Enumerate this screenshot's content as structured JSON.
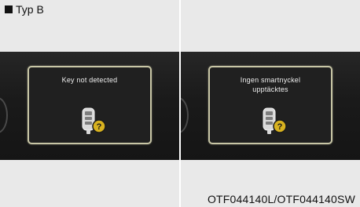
{
  "section": {
    "label": "Typ B"
  },
  "screens": [
    {
      "message": "Key not detected"
    },
    {
      "message": "Ingen smartnyckel\nupptäcktes"
    }
  ],
  "icons": {
    "key": "smart-key-icon",
    "question": "question-mark-icon"
  },
  "colors": {
    "frame": "#c8c6a6",
    "badge": "#d8b21f",
    "cluster": "#1c1c1c"
  },
  "footer": {
    "code": "OTF044140L/OTF044140SW"
  }
}
